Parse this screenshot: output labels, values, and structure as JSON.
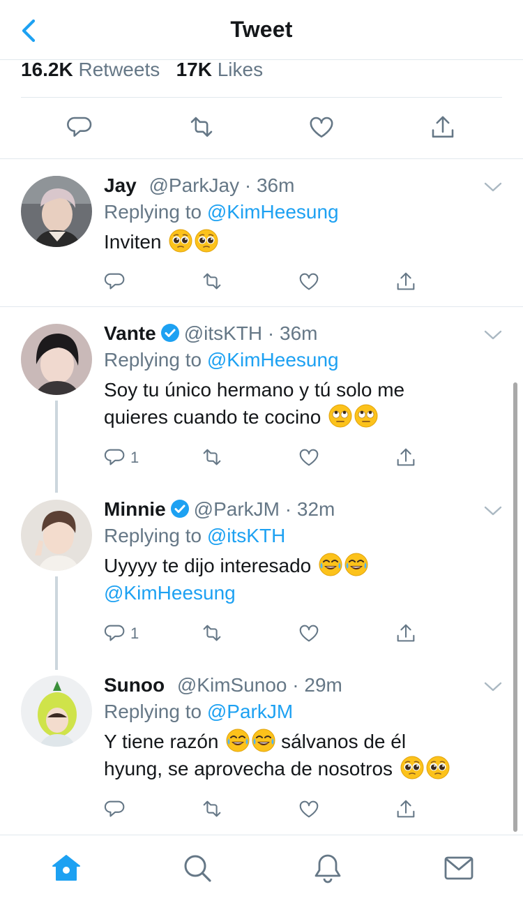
{
  "header": {
    "title": "Tweet"
  },
  "stats": {
    "retweets_count": "16.2K",
    "retweets_label": "Retweets",
    "likes_count": "17K",
    "likes_label": "Likes"
  },
  "replies": [
    {
      "name": "Jay",
      "verified": false,
      "handle": "@ParkJay",
      "time": "36m",
      "replying_prefix": "Replying to",
      "replying_to": "@KimHeesung",
      "text": "Inviten",
      "reply_count": ""
    },
    {
      "name": "Vante",
      "verified": true,
      "handle": "@itsKTH",
      "time": "36m",
      "replying_prefix": "Replying to",
      "replying_to": "@KimHeesung",
      "text_line1": "Soy tu único hermano y tú solo me",
      "text_line2": "quieres cuando te cocino",
      "reply_count": "1"
    },
    {
      "name": "Minnie",
      "verified": true,
      "handle": "@ParkJM",
      "time": "32m",
      "replying_prefix": "Replying to",
      "replying_to": "@itsKTH",
      "text_line1": "Uyyyy te dijo interesado",
      "text_mention": "@KimHeesung",
      "reply_count": "1"
    },
    {
      "name": "Sunoo",
      "verified": false,
      "handle": "@KimSunoo",
      "time": "29m",
      "replying_prefix": "Replying to",
      "replying_to": "@ParkJM",
      "text_part1": "Y tiene razón",
      "text_part2": "sálvanos de él",
      "text_line2": "hyung, se aprovecha de nosotros",
      "reply_count": ""
    }
  ],
  "tabs": [
    "home-icon",
    "search-icon",
    "notifications-icon",
    "messages-icon"
  ],
  "colors": {
    "accent": "#1da1f2",
    "secondary_text": "#657786",
    "divider": "#e1e8ed",
    "verified": "#1da1f2"
  }
}
